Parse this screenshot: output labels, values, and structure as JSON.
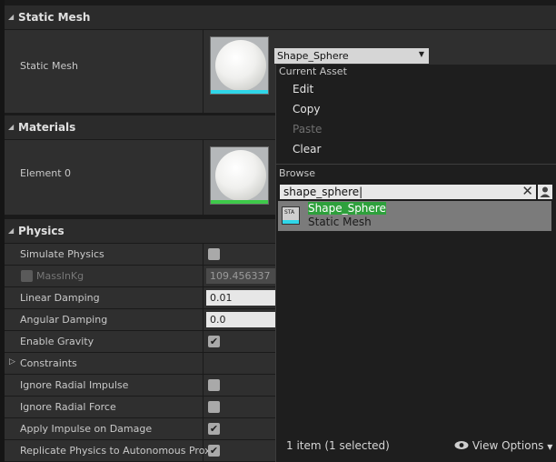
{
  "static_mesh_section": {
    "title": "Static Mesh",
    "property_label": "Static Mesh",
    "bar_color": "#2fd6e8"
  },
  "materials_section": {
    "title": "Materials",
    "element_label": "Element 0",
    "bar_color": "#3ec94a"
  },
  "physics_section": {
    "title": "Physics",
    "simulate_physics": {
      "label": "Simulate Physics",
      "checked": false
    },
    "mass": {
      "label": "MassInKg",
      "value": "109.456337",
      "enabled": false
    },
    "linear_damping": {
      "label": "Linear Damping",
      "value": "0.01"
    },
    "angular_damping": {
      "label": "Angular Damping",
      "value": "0.0"
    },
    "enable_gravity": {
      "label": "Enable Gravity",
      "checked": true
    },
    "constraints": {
      "label": "Constraints"
    },
    "ignore_radial_impulse": {
      "label": "Ignore Radial Impulse",
      "checked": false
    },
    "ignore_radial_force": {
      "label": "Ignore Radial Force",
      "checked": false
    },
    "apply_impulse_on_damage": {
      "label": "Apply Impulse on Damage",
      "checked": true
    },
    "replicate_physics": {
      "label": "Replicate Physics to Autonomous Proxy",
      "checked": true
    }
  },
  "combo": {
    "value": "Shape_Sphere"
  },
  "popup": {
    "current_asset_header": "Current Asset",
    "menu": {
      "edit": "Edit",
      "copy": "Copy",
      "paste": "Paste",
      "clear": "Clear"
    },
    "browse_header": "Browse",
    "search_value": "shape_sphere",
    "result": {
      "name": "Shape_Sphere",
      "type": "Static Mesh",
      "icon_text": "STA"
    },
    "footer_count": "1 item (1 selected)",
    "view_options": "View Options"
  },
  "icons": {
    "checkmark": "✔",
    "collapse": "◢",
    "expand": "▷",
    "caret": "▼",
    "clear": "✕",
    "eye": "👁"
  }
}
